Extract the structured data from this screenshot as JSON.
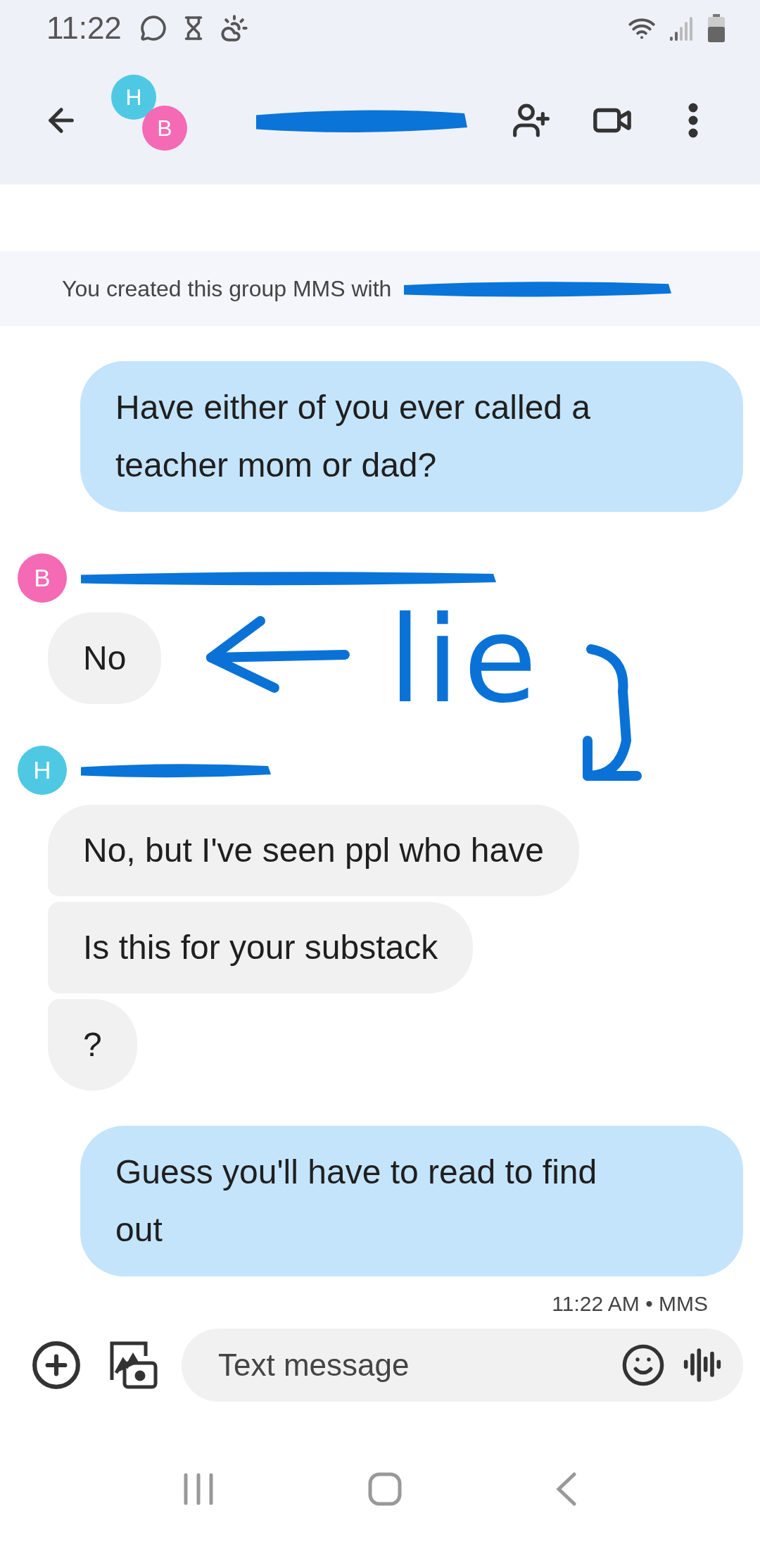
{
  "status_bar": {
    "time": "11:22"
  },
  "header": {
    "avatars": [
      {
        "initial": "H",
        "color": "#4fc9e3"
      },
      {
        "initial": "B",
        "color": "#f46ab5"
      }
    ]
  },
  "notice": {
    "text": "You created this group MMS with"
  },
  "messages": [
    {
      "kind": "outgoing",
      "texts": [
        "Have either of you ever called a teacher mom or dad?"
      ]
    },
    {
      "kind": "incoming",
      "avatar": {
        "initial": "B",
        "color": "#f46ab5"
      },
      "texts": [
        "No"
      ]
    },
    {
      "kind": "incoming",
      "avatar": {
        "initial": "H",
        "color": "#4fc9e3"
      },
      "texts": [
        "No, but I've seen ppl who have",
        "Is this for your substack",
        "?"
      ]
    },
    {
      "kind": "outgoing",
      "texts": [
        "Guess you'll have to read to find out"
      ],
      "meta": "11:22 AM • MMS"
    }
  ],
  "annotation": {
    "text": "lie"
  },
  "composer": {
    "placeholder": "Text message"
  }
}
